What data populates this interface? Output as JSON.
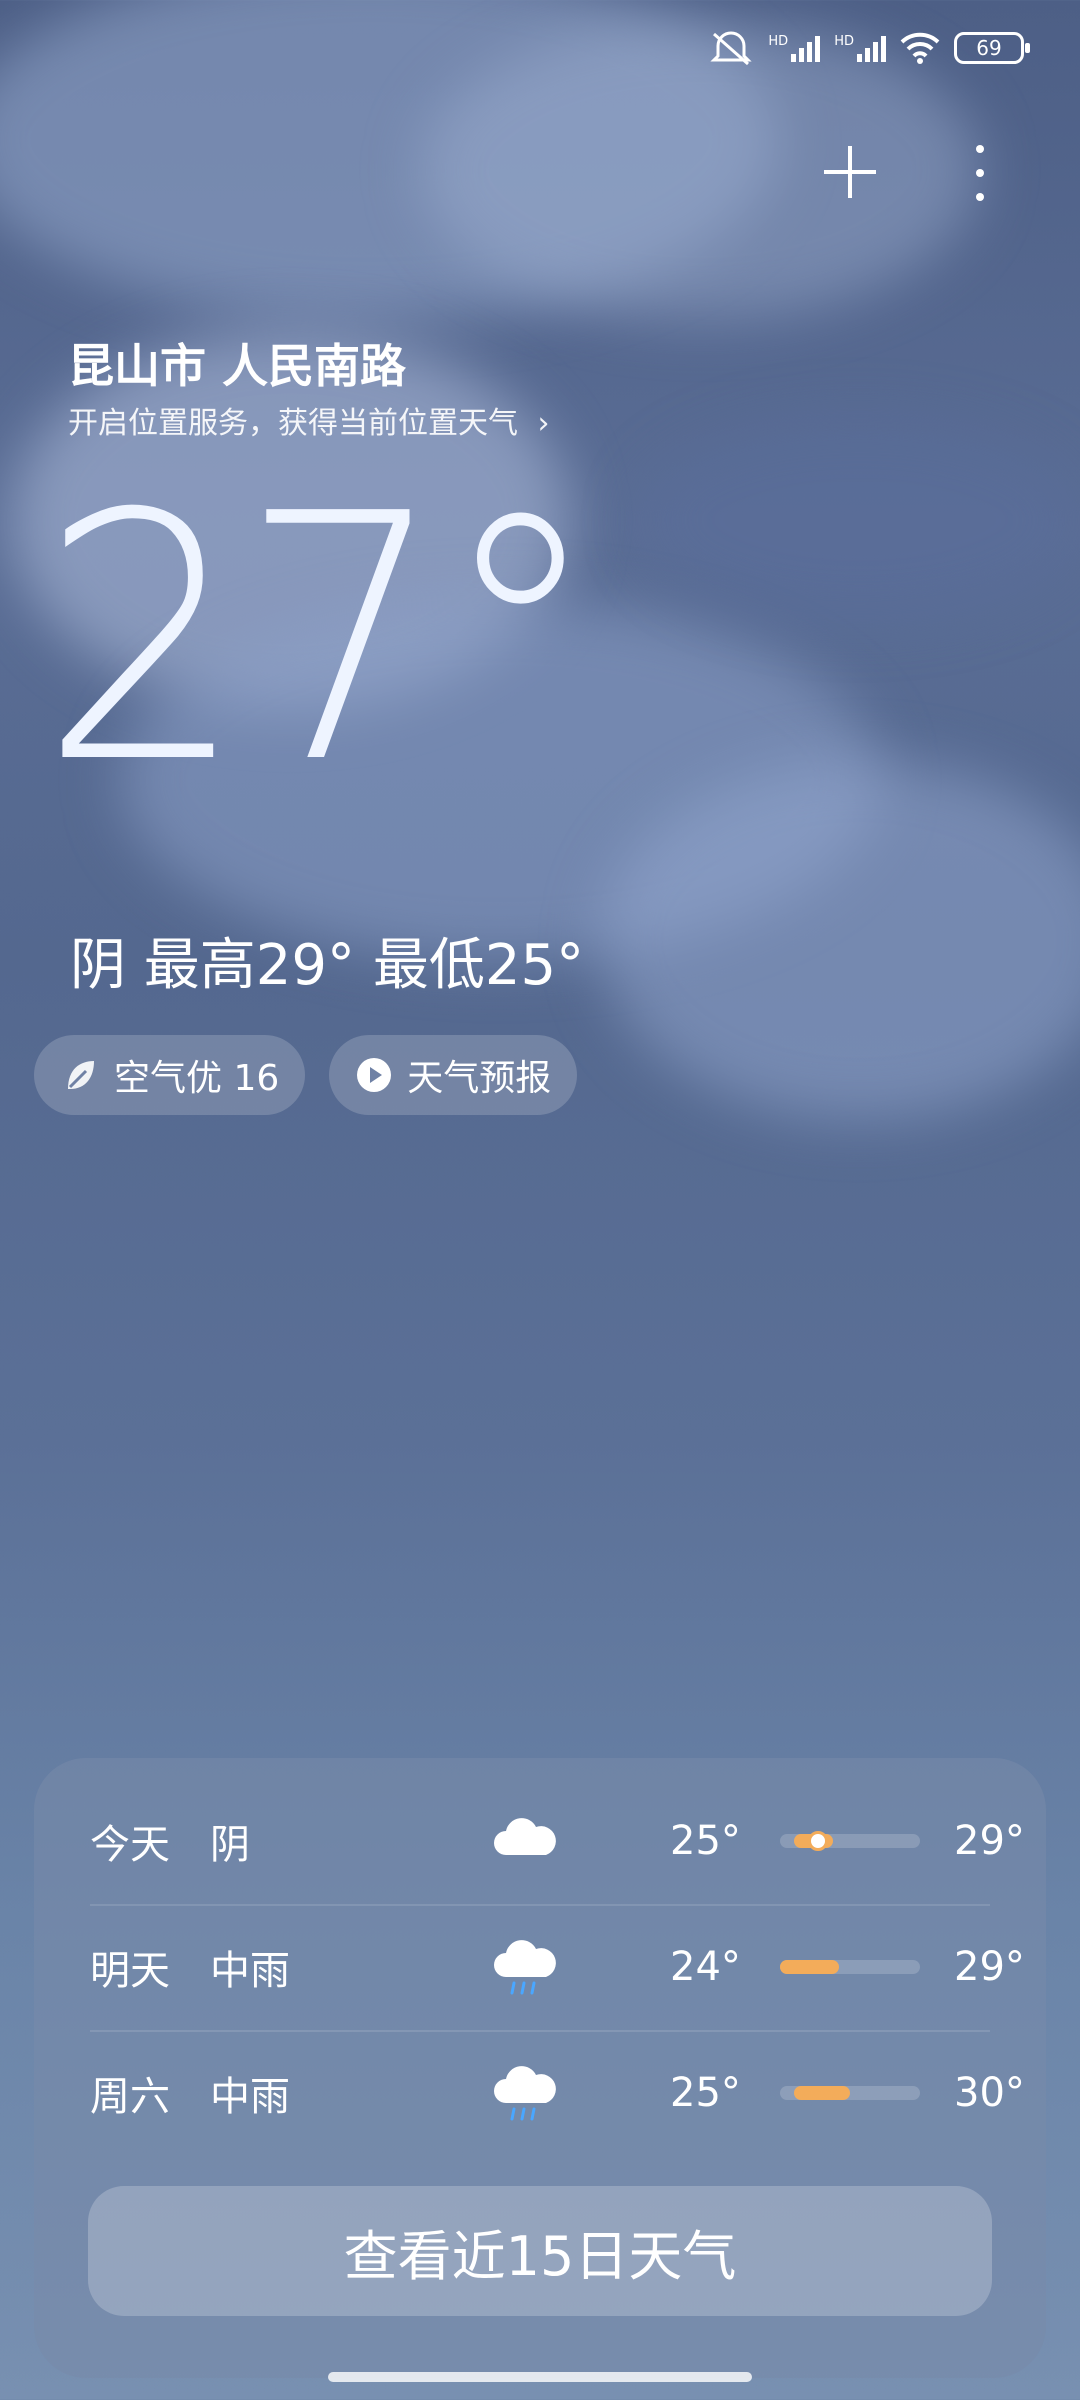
{
  "status_bar": {
    "time": "",
    "hd1": "HD",
    "hd2": "HD",
    "battery": "69"
  },
  "header": {
    "location": "昆山市 人民南路",
    "location_hint": "开启位置服务，获得当前位置天气"
  },
  "current": {
    "temperature": "27°",
    "summary": "阴  最高29° 最低25°"
  },
  "chips": {
    "air": "空气优 16",
    "forecast": "天气预报"
  },
  "forecast_rows": [
    {
      "day": "今天",
      "condition": "阴",
      "icon": "cloud-icon",
      "low": "25°",
      "high": "29°",
      "range": {
        "start": 0.1,
        "end": 0.38
      },
      "current_marker": 0.25
    },
    {
      "day": "明天",
      "condition": "中雨",
      "icon": "rain-icon",
      "low": "24°",
      "high": "29°",
      "range": {
        "start": 0.0,
        "end": 0.42
      }
    },
    {
      "day": "周六",
      "condition": "中雨",
      "icon": "rain-icon",
      "low": "25°",
      "high": "30°",
      "range": {
        "start": 0.1,
        "end": 0.5
      }
    }
  ],
  "cta": {
    "label": "查看近15日天气"
  },
  "colors": {
    "accent": "#f3ac5a"
  }
}
